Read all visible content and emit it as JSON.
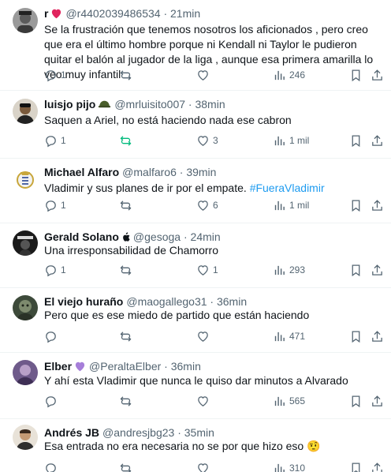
{
  "tweets": [
    {
      "name": "r",
      "name_badge": "heart",
      "handle": "@r4402039486534",
      "sep": "·",
      "time": "21min",
      "text": "Se la frustración que tenemos nosotros los aficionados , pero creo que era el último hombre porque ni Kendall ni Taylor le pudieron quitar el balón al jugador de la liga , aunque esa primera amarilla lo veo muy infantil",
      "replies": "1",
      "reposts": "",
      "likes": "",
      "views": "246"
    },
    {
      "name": "luisjo pijo",
      "name_badge": "helmet",
      "handle": "@mrluisito007",
      "sep": "·",
      "time": "38min",
      "text": "Saquen a Ariel, no está haciendo nada ese cabron",
      "replies": "1",
      "reposts": "",
      "likes": "3",
      "views": "1 mil",
      "repost_highlight": true
    },
    {
      "name": "Michael Alfaro",
      "name_badge": "",
      "handle": "@malfaro6",
      "sep": "·",
      "time": "39min",
      "text": "Vladimir y sus planes de ir por el empate. ",
      "hashtag": "#FueraVladimir",
      "replies": "1",
      "reposts": "",
      "likes": "6",
      "views": "1 mil"
    },
    {
      "name": "Gerald Solano",
      "name_badge": "apple",
      "handle": "@gesoga",
      "sep": "·",
      "time": "24min",
      "text": "Una irresponsabilidad de Chamorro",
      "replies": "1",
      "reposts": "",
      "likes": "1",
      "views": "293"
    },
    {
      "name": "El viejo huraño",
      "name_badge": "",
      "handle": "@maogallego31",
      "sep": "·",
      "time": "36min",
      "text": "Pero que es ese miedo de partido que están haciendo",
      "replies": "",
      "reposts": "",
      "likes": "",
      "views": "471"
    },
    {
      "name": "Elber",
      "name_badge": "purple-heart",
      "handle": "@PeraltaElber",
      "sep": "·",
      "time": "36min",
      "text": "Y ahí esta Vladimir que nunca le quiso dar minutos a Alvarado",
      "replies": "",
      "reposts": "",
      "likes": "",
      "views": "565"
    },
    {
      "name": "Andrés JB",
      "name_badge": "",
      "handle": "@andresjbg23",
      "sep": "·",
      "time": "35min",
      "text": "Esa entrada no era necesaria no se por que hizo eso ",
      "emoji": "🤨",
      "replies": "",
      "reposts": "",
      "likes": "",
      "views": "310"
    }
  ],
  "colors": {
    "text": "#0f1419",
    "muted": "#536471",
    "link": "#1d9bf0",
    "repost_active": "#00ba7c",
    "divider": "#eff3f4"
  },
  "icons": [
    "reply-icon",
    "repost-icon",
    "like-icon",
    "views-icon",
    "bookmark-icon",
    "share-icon"
  ]
}
